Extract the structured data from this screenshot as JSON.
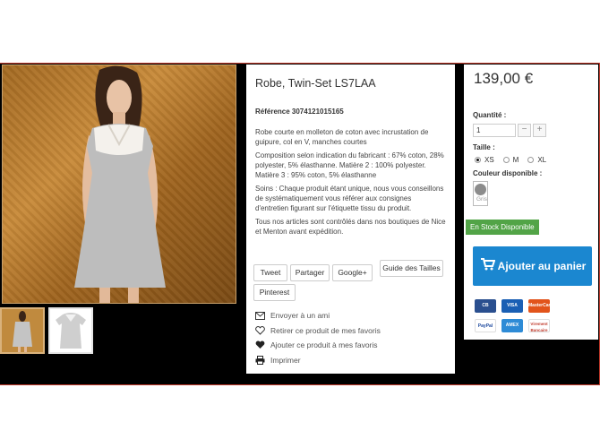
{
  "product": {
    "title": "Robe, Twin-Set LS7LAA",
    "reference": "Référence 3074121015165",
    "description": [
      "Robe courte en molleton de coton avec incrustation de guipure, col en V, manches courtes",
      "Composition selon indication du fabricant : 67% coton, 28% polyester, 5% élasthanne. Matière 2 : 100% polyester. Matière 3 : 95% coton, 5% élasthanne",
      "Soins : Chaque produit étant unique, nous vous conseillons de systématiquement vous référer aux consignes d'entretien figurant sur l'étiquette tissu du produit.",
      "Tous nos articles sont contrôlés dans nos boutiques de Nice et Menton avant expédition."
    ]
  },
  "social": {
    "tweet": "Tweet",
    "share": "Partager",
    "google": "Google+",
    "pinterest": "Pinterest",
    "size_guide": "Guide des Tailles"
  },
  "actions": {
    "email": "Envoyer à un ami",
    "remove_fav": "Retirer ce produit de mes favoris",
    "add_fav": "Ajouter ce produit à mes favoris",
    "print": "Imprimer"
  },
  "buy": {
    "price": "139,00 €",
    "quantity_label": "Quantité :",
    "quantity_value": "1",
    "minus": "−",
    "plus": "+",
    "size_label": "Taille :",
    "sizes": [
      "XS",
      "M",
      "XL"
    ],
    "selected_size": "XS",
    "color_label": "Couleur disponible :",
    "color_name": "Gris",
    "stock": "En Stock Disponible",
    "cart_label": "Ajouter au panier"
  },
  "payment": {
    "cards": [
      "CB",
      "VISA",
      "MasterCard",
      "PayPal",
      "AMEX",
      "Virement Bancaire"
    ]
  },
  "colors": {
    "accent_blue": "#1b87d0",
    "stock_green": "#52a447",
    "frame_red": "#c0392b"
  }
}
